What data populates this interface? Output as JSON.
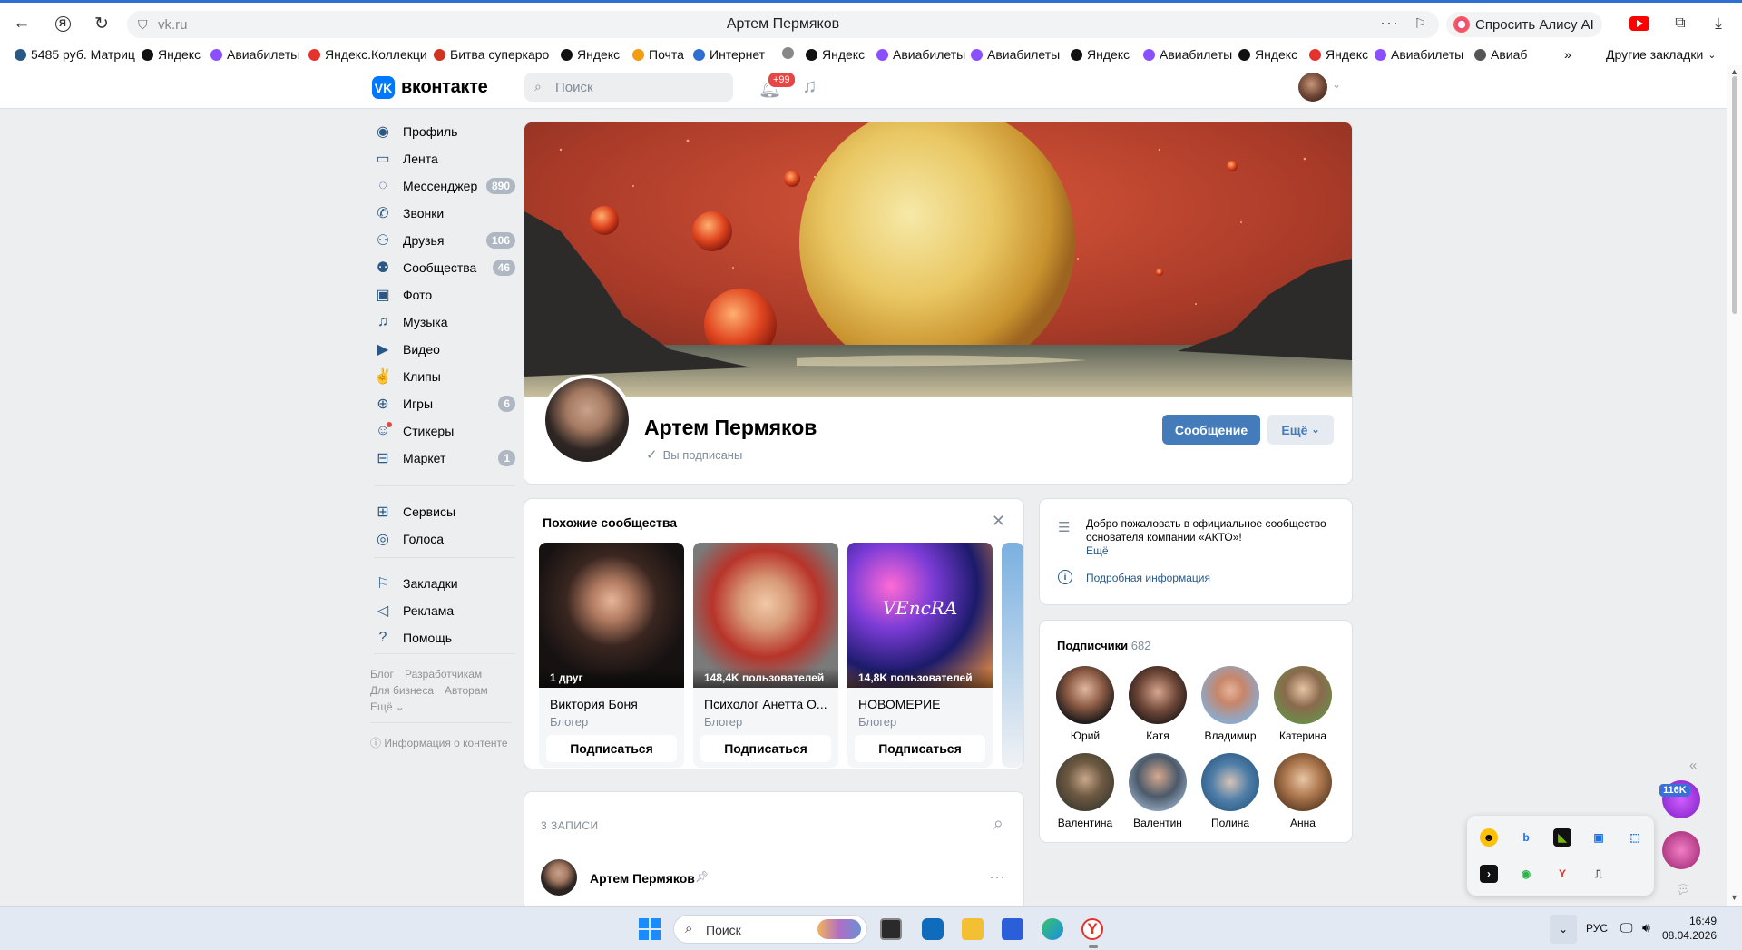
{
  "browser": {
    "url": "vk.ru",
    "title": "Артем Пермяков",
    "alice_label": "Спросить Алису AI",
    "more_dots": "···",
    "bookmarks": [
      {
        "label": "5485 руб. Матриц",
        "color": "#2a5885"
      },
      {
        "label": "Яндекс",
        "color": "#111"
      },
      {
        "label": "Авиабилеты",
        "color": "#8a4fff"
      },
      {
        "label": "Яндекс.Коллекци",
        "color": "#e5322d"
      },
      {
        "label": "Битва суперкаро",
        "color": "#d0331e"
      },
      {
        "label": "Яндекс",
        "color": "#111"
      },
      {
        "label": "Почта",
        "color": "#f39c12"
      },
      {
        "label": "Интернет",
        "color": "#2f6fd1"
      },
      {
        "label": "",
        "color": "#888"
      },
      {
        "label": "Яндекс",
        "color": "#111"
      },
      {
        "label": "Авиабилеты",
        "color": "#8a4fff"
      },
      {
        "label": "Авиабилеты",
        "color": "#8a4fff"
      },
      {
        "label": "Яндекс",
        "color": "#111"
      },
      {
        "label": "Авиабилеты",
        "color": "#8a4fff"
      },
      {
        "label": "Яндекс",
        "color": "#111"
      },
      {
        "label": "Яндекс",
        "color": "#e5322d"
      },
      {
        "label": "Авиабилеты",
        "color": "#8a4fff"
      },
      {
        "label": "Авиаб",
        "color": "#555"
      }
    ],
    "more_chevron": "»",
    "other_bookmarks": "Другие закладки"
  },
  "vk": {
    "logo_word": "вконтакте",
    "logo_mark": "VK",
    "search_placeholder": "Поиск",
    "notif_badge": "+99",
    "accent": "#0077ff"
  },
  "sidebar": {
    "items": [
      {
        "label": "Профиль",
        "count": "",
        "icon": "user-circle-icon",
        "glyph": "◉"
      },
      {
        "label": "Лента",
        "count": "",
        "icon": "feed-icon",
        "glyph": "▭"
      },
      {
        "label": "Мессенджер",
        "count": "890",
        "icon": "message-icon",
        "glyph": "◌"
      },
      {
        "label": "Звонки",
        "count": "",
        "icon": "phone-icon",
        "glyph": "✆"
      },
      {
        "label": "Друзья",
        "count": "106",
        "icon": "friends-icon",
        "glyph": "⚇"
      },
      {
        "label": "Сообщества",
        "count": "46",
        "icon": "communities-icon",
        "glyph": "⚉"
      },
      {
        "label": "Фото",
        "count": "",
        "icon": "photo-icon",
        "glyph": "▣"
      },
      {
        "label": "Музыка",
        "count": "",
        "icon": "music-icon",
        "glyph": "♫"
      },
      {
        "label": "Видео",
        "count": "",
        "icon": "video-icon",
        "glyph": "▶"
      },
      {
        "label": "Клипы",
        "count": "",
        "icon": "clips-icon",
        "glyph": "✌"
      },
      {
        "label": "Игры",
        "count": "6",
        "icon": "games-icon",
        "glyph": "⊕"
      },
      {
        "label": "Стикеры",
        "count": "",
        "icon": "stickers-icon",
        "glyph": "☺"
      },
      {
        "label": "Маркет",
        "count": "1",
        "icon": "market-icon",
        "glyph": "⊟"
      }
    ],
    "items2": [
      {
        "label": "Сервисы",
        "icon": "services-icon",
        "glyph": "⊞"
      },
      {
        "label": "Голоса",
        "icon": "votes-icon",
        "glyph": "◎"
      }
    ],
    "items3": [
      {
        "label": "Закладки",
        "icon": "bookmark-icon",
        "glyph": "⚐"
      },
      {
        "label": "Реклама",
        "icon": "ads-icon",
        "glyph": "◁"
      },
      {
        "label": "Помощь",
        "icon": "help-icon",
        "glyph": "?"
      }
    ],
    "footer": {
      "blog": "Блог",
      "dev": "Разработчикам",
      "biz": "Для бизнеса",
      "authors": "Авторам",
      "more": "Ещё",
      "content_info": "Информация о контенте"
    }
  },
  "profile": {
    "name": "Артем Пермяков",
    "subscribed": "Вы подписаны",
    "message_btn": "Сообщение",
    "more_btn": "Ещё"
  },
  "similar": {
    "title": "Похожие сообщества",
    "items": [
      {
        "overlay": "1 друг",
        "name": "Виктория Боня",
        "category": "Блогер",
        "button": "Подписаться"
      },
      {
        "overlay": "148,4K пользователей",
        "name": "Психолог Анетта О...",
        "category": "Блогер",
        "button": "Подписаться"
      },
      {
        "overlay": "14,8K пользователей",
        "name": "НОВОМЕРИЕ",
        "category": "Блогер",
        "button": "Подписаться"
      }
    ]
  },
  "info": {
    "text": "Добро пожаловать в официальное сообщество основателя компании «АКТО»!",
    "more": "Ещё",
    "detail": "Подробная информация"
  },
  "subscribers": {
    "title": "Подписчики",
    "count": "682",
    "people": [
      "Юрий",
      "Катя",
      "Владимир",
      "Катерина",
      "Валентина",
      "Валентин",
      "Полина",
      "Анна"
    ]
  },
  "wall": {
    "title": "3 ЗАПИСИ",
    "author": "Артем Пермяков"
  },
  "widget": {
    "badge": "116K"
  },
  "taskbar": {
    "search_placeholder": "Поиск",
    "lang": "РУС",
    "time": "16:49",
    "date": "08.04.2026"
  }
}
